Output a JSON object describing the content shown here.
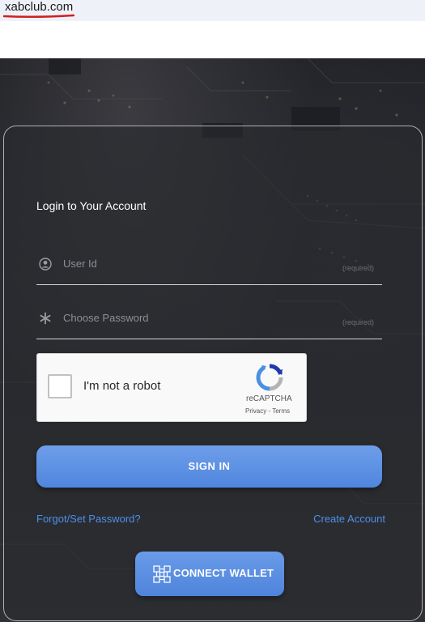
{
  "browser": {
    "domain": "xabclub.com"
  },
  "login": {
    "title": "Login to Your Account",
    "user_id": {
      "placeholder": "User Id",
      "required_hint": "(required)",
      "icon": "user-circle-icon"
    },
    "password": {
      "placeholder": "Choose Password",
      "required_hint": "(required)",
      "icon": "asterisk-icon"
    },
    "captcha": {
      "label": "I'm not a robot",
      "brand": "reCAPTCHA",
      "privacy": "Privacy",
      "separator": " - ",
      "terms": "Terms",
      "checked": false
    },
    "sign_in_label": "SIGN IN",
    "forgot_label": "Forgot/Set Password?",
    "create_label": "Create Account",
    "connect_wallet_label": "CONNECT WALLET"
  },
  "colors": {
    "accent": "#5a8fe3",
    "link": "#4f8fea",
    "underline": "#d21f1f"
  }
}
